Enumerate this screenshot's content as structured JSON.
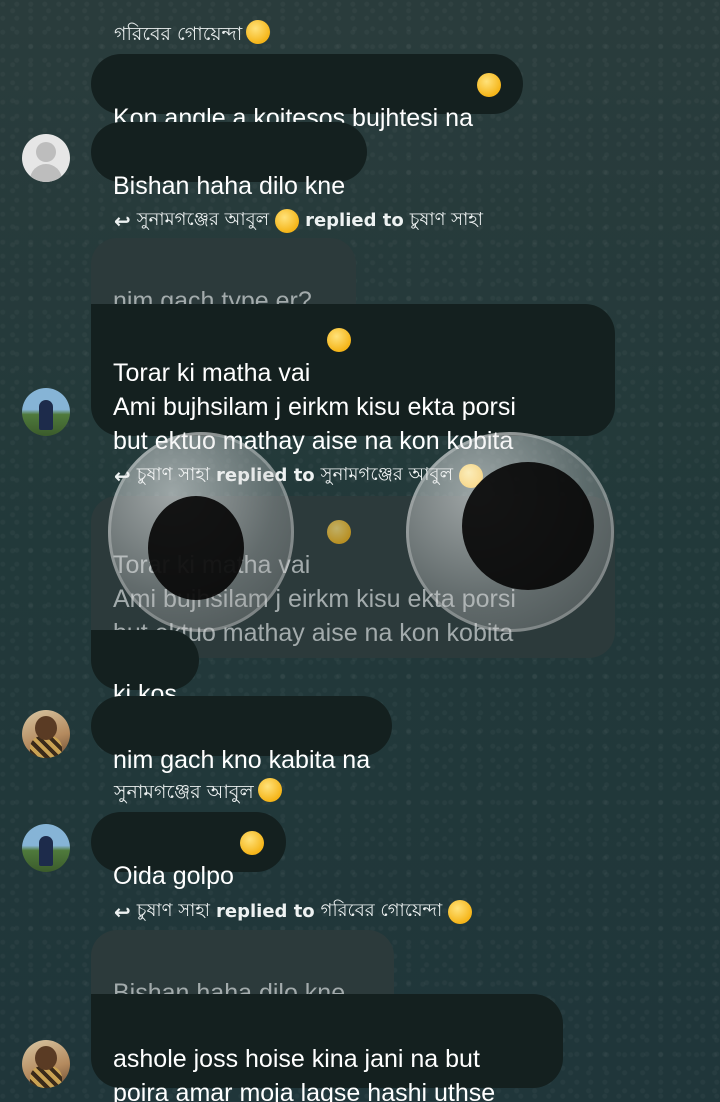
{
  "messages": {
    "sender1": "গরিবের গোয়েন্দা",
    "m1": "Kon angle a koitesos bujhtesi na",
    "m2": "Bishan haha dilo kne",
    "reply1": {
      "from": "সুনামগঞ্জের আবুল",
      "replied_label": "replied to",
      "to": "চুষাণ সাহা",
      "quoted": "nim gach type er?",
      "text": "Torar ki matha vai \nAmi bujhsilam j eirkm kisu ekta porsi\nbut ektuo mathay aise na kon kobita"
    },
    "reply2": {
      "from": "চুষাণ সাহা",
      "replied_label": "replied to",
      "to": "সুনামগঞ্জের আবুল",
      "quoted": "Torar ki matha vai \nAmi bujhsilam j eirkm kisu ekta porsi\nbut ektuo mathay aise na kon kobita"
    },
    "m3": "ki kos",
    "m4": "nim gach kno kabita na",
    "sender2": "সুনামগঞ্জের আবুল",
    "m5": "Oida golpo",
    "reply3": {
      "from": "চুষাণ সাহা",
      "replied_label": "replied to",
      "to": "গরিবের গোয়েন্দা",
      "quoted": "Bishan haha dilo kne",
      "text": "ashole joss hoise kina jani na but\npoira amar moja lagse hashi uthse"
    }
  },
  "icons": {
    "reply": "reply-arrow-icon",
    "emoji": "emoji-icon",
    "avatar": "avatar-icon"
  },
  "colors": {
    "bubble": "#14201f",
    "quoted_bubble": "#2c3a3b",
    "background": "#233535"
  }
}
